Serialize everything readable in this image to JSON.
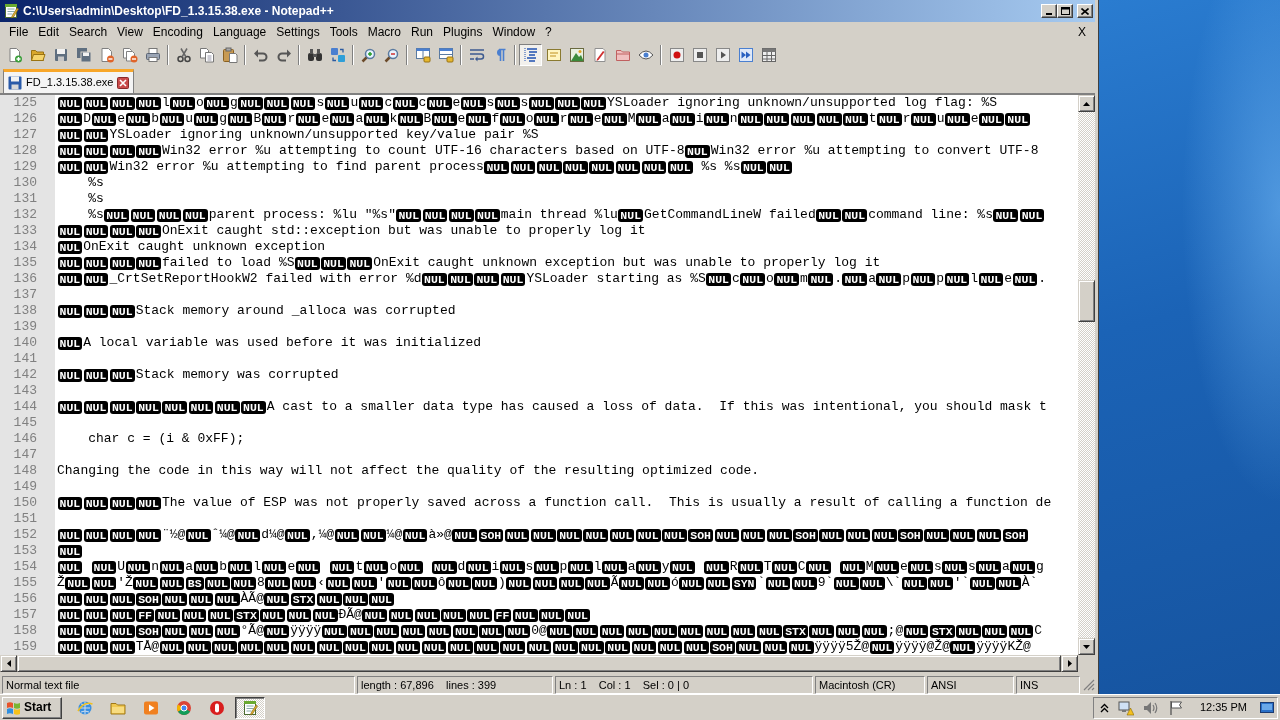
{
  "window": {
    "title": "C:\\Users\\admin\\Desktop\\FD_1.3.15.38.exe - Notepad++"
  },
  "menu": [
    "File",
    "Edit",
    "Search",
    "View",
    "Encoding",
    "Language",
    "Settings",
    "Tools",
    "Macro",
    "Run",
    "Plugins",
    "Window",
    "?"
  ],
  "menu_close": "X",
  "toolbar": [
    [
      {
        "pressed": false
      },
      {
        "pressed": false
      },
      {
        "pressed": false
      },
      {
        "pressed": false
      },
      {
        "pressed": false
      },
      {
        "pressed": false
      },
      {
        "pressed": false
      }
    ],
    [
      {
        "pressed": false
      },
      {
        "pressed": false
      },
      {
        "pressed": false
      }
    ],
    [
      {
        "pressed": false
      },
      {
        "pressed": false
      }
    ],
    [
      {
        "pressed": false
      },
      {
        "pressed": false
      }
    ],
    [
      {
        "pressed": false
      },
      {
        "pressed": false
      }
    ],
    [
      {
        "pressed": false
      },
      {
        "pressed": false
      }
    ],
    [
      {
        "pressed": false
      },
      {
        "pressed": false
      }
    ],
    [
      {
        "pressed": true
      },
      {
        "pressed": false
      },
      {
        "pressed": false
      },
      {
        "pressed": false
      },
      {
        "pressed": false
      },
      {
        "pressed": false
      }
    ],
    [
      {
        "pressed": false
      },
      {
        "pressed": false
      },
      {
        "pressed": false
      },
      {
        "pressed": false
      },
      {
        "pressed": false
      }
    ]
  ],
  "tabs": [
    {
      "label": "FD_1.3.15.38.exe",
      "selected": true,
      "modified": false
    }
  ],
  "editor": {
    "lines": [
      {
        "number": "125",
        "segments": [
          {
            "ctrl": "NUL"
          },
          {
            "ctrl": "NUL"
          },
          {
            "ctrl": "NUL"
          },
          {
            "ctrl": "NUL"
          },
          {
            "text": "l"
          },
          {
            "ctrl": "NUL"
          },
          {
            "text": "o"
          },
          {
            "ctrl": "NUL"
          },
          {
            "text": "g"
          },
          {
            "ctrl": "NUL"
          },
          {
            "ctrl": "NUL"
          },
          {
            "ctrl": "NUL"
          },
          {
            "text": "s"
          },
          {
            "ctrl": "NUL"
          },
          {
            "text": "u"
          },
          {
            "ctrl": "NUL"
          },
          {
            "text": "c"
          },
          {
            "ctrl": "NUL"
          },
          {
            "text": "c"
          },
          {
            "ctrl": "NUL"
          },
          {
            "text": "e"
          },
          {
            "ctrl": "NUL"
          },
          {
            "text": "s"
          },
          {
            "ctrl": "NUL"
          },
          {
            "text": "s"
          },
          {
            "ctrl": "NUL"
          },
          {
            "ctrl": "NUL"
          },
          {
            "ctrl": "NUL"
          },
          {
            "text": "YSLoader ignoring unknown/unsupported log flag: %S"
          }
        ]
      },
      {
        "number": "126",
        "segments": [
          {
            "ctrl": "NUL"
          },
          {
            "text": "D"
          },
          {
            "ctrl": "NUL"
          },
          {
            "text": "e"
          },
          {
            "ctrl": "NUL"
          },
          {
            "text": "b"
          },
          {
            "ctrl": "NUL"
          },
          {
            "text": "u"
          },
          {
            "ctrl": "NUL"
          },
          {
            "text": "g"
          },
          {
            "ctrl": "NUL"
          },
          {
            "text": "B"
          },
          {
            "ctrl": "NUL"
          },
          {
            "text": "r"
          },
          {
            "ctrl": "NUL"
          },
          {
            "text": "e"
          },
          {
            "ctrl": "NUL"
          },
          {
            "text": "a"
          },
          {
            "ctrl": "NUL"
          },
          {
            "text": "k"
          },
          {
            "ctrl": "NUL"
          },
          {
            "text": "B"
          },
          {
            "ctrl": "NUL"
          },
          {
            "text": "e"
          },
          {
            "ctrl": "NUL"
          },
          {
            "text": "f"
          },
          {
            "ctrl": "NUL"
          },
          {
            "text": "o"
          },
          {
            "ctrl": "NUL"
          },
          {
            "text": "r"
          },
          {
            "ctrl": "NUL"
          },
          {
            "text": "e"
          },
          {
            "ctrl": "NUL"
          },
          {
            "text": "M"
          },
          {
            "ctrl": "NUL"
          },
          {
            "text": "a"
          },
          {
            "ctrl": "NUL"
          },
          {
            "text": "i"
          },
          {
            "ctrl": "NUL"
          },
          {
            "text": "n"
          },
          {
            "ctrl": "NUL"
          },
          {
            "ctrl": "NUL"
          },
          {
            "ctrl": "NUL"
          },
          {
            "ctrl": "NUL"
          },
          {
            "ctrl": "NUL"
          },
          {
            "text": "t"
          },
          {
            "ctrl": "NUL"
          },
          {
            "text": "r"
          },
          {
            "ctrl": "NUL"
          },
          {
            "text": "u"
          },
          {
            "ctrl": "NUL"
          },
          {
            "text": "e"
          },
          {
            "ctrl": "NUL"
          },
          {
            "ctrl": "NUL"
          }
        ]
      },
      {
        "number": "127",
        "segments": [
          {
            "ctrl": "NUL"
          },
          {
            "ctrl": "NUL"
          },
          {
            "text": "YSLoader ignoring unknown/unsupported key/value pair %S"
          }
        ]
      },
      {
        "number": "128",
        "segments": [
          {
            "ctrl": "NUL"
          },
          {
            "ctrl": "NUL"
          },
          {
            "ctrl": "NUL"
          },
          {
            "ctrl": "NUL"
          },
          {
            "text": "Win32 error %u attempting to count UTF-16 characters based on UTF-8"
          },
          {
            "ctrl": "NUL"
          },
          {
            "text": "Win32 error %u attempting to convert UTF-8"
          }
        ]
      },
      {
        "number": "129",
        "segments": [
          {
            "ctrl": "NUL"
          },
          {
            "ctrl": "NUL"
          },
          {
            "text": "Win32 error %u attempting to find parent process"
          },
          {
            "ctrl": "NUL"
          },
          {
            "ctrl": "NUL"
          },
          {
            "ctrl": "NUL"
          },
          {
            "ctrl": "NUL"
          },
          {
            "ctrl": "NUL"
          },
          {
            "ctrl": "NUL"
          },
          {
            "ctrl": "NUL"
          },
          {
            "ctrl": "NUL"
          },
          {
            "text": " %s %s"
          },
          {
            "ctrl": "NUL"
          },
          {
            "ctrl": "NUL"
          }
        ]
      },
      {
        "number": "130",
        "segments": [
          {
            "text": "    %s"
          }
        ]
      },
      {
        "number": "131",
        "segments": [
          {
            "text": "    %s"
          }
        ]
      },
      {
        "number": "132",
        "segments": [
          {
            "text": "    %s"
          },
          {
            "ctrl": "NUL"
          },
          {
            "ctrl": "NUL"
          },
          {
            "ctrl": "NUL"
          },
          {
            "ctrl": "NUL"
          },
          {
            "text": "parent process: %lu \"%s\""
          },
          {
            "ctrl": "NUL"
          },
          {
            "ctrl": "NUL"
          },
          {
            "ctrl": "NUL"
          },
          {
            "ctrl": "NUL"
          },
          {
            "text": "main thread %lu"
          },
          {
            "ctrl": "NUL"
          },
          {
            "text": "GetCommandLineW failed"
          },
          {
            "ctrl": "NUL"
          },
          {
            "ctrl": "NUL"
          },
          {
            "text": "command line: %s"
          },
          {
            "ctrl": "NUL"
          },
          {
            "ctrl": "NUL"
          }
        ]
      },
      {
        "number": "133",
        "segments": [
          {
            "ctrl": "NUL"
          },
          {
            "ctrl": "NUL"
          },
          {
            "ctrl": "NUL"
          },
          {
            "ctrl": "NUL"
          },
          {
            "text": "OnExit caught std::exception but was unable to properly log it"
          }
        ]
      },
      {
        "number": "134",
        "segments": [
          {
            "ctrl": "NUL"
          },
          {
            "text": "OnExit caught unknown exception"
          }
        ]
      },
      {
        "number": "135",
        "segments": [
          {
            "ctrl": "NUL"
          },
          {
            "ctrl": "NUL"
          },
          {
            "ctrl": "NUL"
          },
          {
            "ctrl": "NUL"
          },
          {
            "text": "failed to load %S"
          },
          {
            "ctrl": "NUL"
          },
          {
            "ctrl": "NUL"
          },
          {
            "ctrl": "NUL"
          },
          {
            "text": "OnExit caught unknown exception but was unable to properly log it"
          }
        ]
      },
      {
        "number": "136",
        "segments": [
          {
            "ctrl": "NUL"
          },
          {
            "ctrl": "NUL"
          },
          {
            "text": "_CrtSetReportHookW2 failed with error %d"
          },
          {
            "ctrl": "NUL"
          },
          {
            "ctrl": "NUL"
          },
          {
            "ctrl": "NUL"
          },
          {
            "ctrl": "NUL"
          },
          {
            "text": "YSLoader starting as %S"
          },
          {
            "ctrl": "NUL"
          },
          {
            "text": "c"
          },
          {
            "ctrl": "NUL"
          },
          {
            "text": "o"
          },
          {
            "ctrl": "NUL"
          },
          {
            "text": "m"
          },
          {
            "ctrl": "NUL"
          },
          {
            "text": "."
          },
          {
            "ctrl": "NUL"
          },
          {
            "text": "a"
          },
          {
            "ctrl": "NUL"
          },
          {
            "text": "p"
          },
          {
            "ctrl": "NUL"
          },
          {
            "text": "p"
          },
          {
            "ctrl": "NUL"
          },
          {
            "text": "l"
          },
          {
            "ctrl": "NUL"
          },
          {
            "text": "e"
          },
          {
            "ctrl": "NUL"
          },
          {
            "text": "."
          }
        ]
      },
      {
        "number": "137"
      },
      {
        "number": "138",
        "segments": [
          {
            "ctrl": "NUL"
          },
          {
            "ctrl": "NUL"
          },
          {
            "ctrl": "NUL"
          },
          {
            "text": "Stack memory around _alloca was corrupted"
          }
        ]
      },
      {
        "number": "139"
      },
      {
        "number": "140",
        "segments": [
          {
            "ctrl": "NUL"
          },
          {
            "text": "A local variable was used before it was initialized"
          }
        ]
      },
      {
        "number": "141"
      },
      {
        "number": "142",
        "segments": [
          {
            "ctrl": "NUL"
          },
          {
            "ctrl": "NUL"
          },
          {
            "ctrl": "NUL"
          },
          {
            "text": "Stack memory was corrupted"
          }
        ]
      },
      {
        "number": "143"
      },
      {
        "number": "144",
        "segments": [
          {
            "ctrl": "NUL"
          },
          {
            "ctrl": "NUL"
          },
          {
            "ctrl": "NUL"
          },
          {
            "ctrl": "NUL"
          },
          {
            "ctrl": "NUL"
          },
          {
            "ctrl": "NUL"
          },
          {
            "ctrl": "NUL"
          },
          {
            "ctrl": "NUL"
          },
          {
            "text": "A cast to a smaller data type has caused a loss of data.  If this was intentional, you should mask t"
          }
        ]
      },
      {
        "number": "145"
      },
      {
        "number": "146",
        "segments": [
          {
            "text": "    char c = (i & 0xFF);"
          }
        ]
      },
      {
        "number": "147"
      },
      {
        "number": "148",
        "segments": [
          {
            "text": "Changing the code in this way will not affect the quality of the resulting optimized code."
          }
        ]
      },
      {
        "number": "149"
      },
      {
        "number": "150",
        "segments": [
          {
            "ctrl": "NUL"
          },
          {
            "ctrl": "NUL"
          },
          {
            "ctrl": "NUL"
          },
          {
            "ctrl": "NUL"
          },
          {
            "text": "The value of ESP was not properly saved across a function call.  This is usually a result of calling a function de"
          }
        ]
      },
      {
        "number": "151"
      },
      {
        "number": "152",
        "segments": [
          {
            "ctrl": "NUL"
          },
          {
            "ctrl": "NUL"
          },
          {
            "ctrl": "NUL"
          },
          {
            "ctrl": "NUL"
          },
          {
            "text": "¨½@"
          },
          {
            "ctrl": "NUL"
          },
          {
            "text": "ˆ¼@"
          },
          {
            "ctrl": "NUL"
          },
          {
            "text": "d¼@"
          },
          {
            "ctrl": "NUL"
          },
          {
            "text": ",¼@"
          },
          {
            "ctrl": "NUL"
          },
          {
            "ctrl": "NUL"
          },
          {
            "text": "¼@"
          },
          {
            "ctrl": "NUL"
          },
          {
            "text": "à»@"
          },
          {
            "ctrl": "NUL"
          },
          {
            "ctrl": "SOH"
          },
          {
            "ctrl": "NUL"
          },
          {
            "ctrl": "NUL"
          },
          {
            "ctrl": "NUL"
          },
          {
            "ctrl": "NUL"
          },
          {
            "ctrl": "NUL"
          },
          {
            "ctrl": "NUL"
          },
          {
            "ctrl": "NUL"
          },
          {
            "ctrl": "SOH"
          },
          {
            "ctrl": "NUL"
          },
          {
            "ctrl": "NUL"
          },
          {
            "ctrl": "NUL"
          },
          {
            "ctrl": "SOH"
          },
          {
            "ctrl": "NUL"
          },
          {
            "ctrl": "NUL"
          },
          {
            "ctrl": "NUL"
          },
          {
            "ctrl": "SOH"
          },
          {
            "ctrl": "NUL"
          },
          {
            "ctrl": "NUL"
          },
          {
            "ctrl": "NUL"
          },
          {
            "ctrl": "SOH"
          }
        ]
      },
      {
        "number": "153",
        "segments": [
          {
            "ctrl": "NUL"
          }
        ]
      },
      {
        "number": "154",
        "segments": [
          {
            "ctrl": "NUL"
          },
          {
            "blank": true
          },
          {
            "ctrl": "NUL"
          },
          {
            "text": "U"
          },
          {
            "ctrl": "NUL"
          },
          {
            "text": "n"
          },
          {
            "ctrl": "NUL"
          },
          {
            "text": "a"
          },
          {
            "ctrl": "NUL"
          },
          {
            "text": "b"
          },
          {
            "ctrl": "NUL"
          },
          {
            "text": "l"
          },
          {
            "ctrl": "NUL"
          },
          {
            "text": "e"
          },
          {
            "ctrl": "NUL"
          },
          {
            "blank": true
          },
          {
            "ctrl": "NUL"
          },
          {
            "text": "t"
          },
          {
            "ctrl": "NUL"
          },
          {
            "text": "o"
          },
          {
            "ctrl": "NUL"
          },
          {
            "blank": true
          },
          {
            "ctrl": "NUL"
          },
          {
            "text": "d"
          },
          {
            "ctrl": "NUL"
          },
          {
            "text": "i"
          },
          {
            "ctrl": "NUL"
          },
          {
            "text": "s"
          },
          {
            "ctrl": "NUL"
          },
          {
            "text": "p"
          },
          {
            "ctrl": "NUL"
          },
          {
            "text": "l"
          },
          {
            "ctrl": "NUL"
          },
          {
            "text": "a"
          },
          {
            "ctrl": "NUL"
          },
          {
            "text": "y"
          },
          {
            "ctrl": "NUL"
          },
          {
            "blank": true
          },
          {
            "ctrl": "NUL"
          },
          {
            "text": "R"
          },
          {
            "ctrl": "NUL"
          },
          {
            "text": "T"
          },
          {
            "ctrl": "NUL"
          },
          {
            "text": "C"
          },
          {
            "ctrl": "NUL"
          },
          {
            "blank": true
          },
          {
            "ctrl": "NUL"
          },
          {
            "text": "M"
          },
          {
            "ctrl": "NUL"
          },
          {
            "text": "e"
          },
          {
            "ctrl": "NUL"
          },
          {
            "text": "s"
          },
          {
            "ctrl": "NUL"
          },
          {
            "text": "s"
          },
          {
            "ctrl": "NUL"
          },
          {
            "text": "a"
          },
          {
            "ctrl": "NUL"
          },
          {
            "text": "g"
          }
        ]
      },
      {
        "number": "155",
        "segments": [
          {
            "text": "Ž"
          },
          {
            "ctrl": "NUL"
          },
          {
            "ctrl": "NUL"
          },
          {
            "text": "'Ž"
          },
          {
            "ctrl": "NUL"
          },
          {
            "ctrl": "NUL"
          },
          {
            "ctrl": "BS"
          },
          {
            "ctrl": "NUL"
          },
          {
            "ctrl": "NUL"
          },
          {
            "text": "8"
          },
          {
            "ctrl": "NUL"
          },
          {
            "ctrl": "NUL"
          },
          {
            "text": "‹"
          },
          {
            "ctrl": "NUL"
          },
          {
            "ctrl": "NUL"
          },
          {
            "text": "'"
          },
          {
            "ctrl": "NUL"
          },
          {
            "ctrl": "NUL"
          },
          {
            "text": "ô"
          },
          {
            "ctrl": "NUL"
          },
          {
            "ctrl": "NUL"
          },
          {
            "text": ")"
          },
          {
            "ctrl": "NUL"
          },
          {
            "ctrl": "NUL"
          },
          {
            "ctrl": "NUL"
          },
          {
            "ctrl": "NUL"
          },
          {
            "text": "Ã"
          },
          {
            "ctrl": "NUL"
          },
          {
            "ctrl": "NUL"
          },
          {
            "text": "ó"
          },
          {
            "ctrl": "NUL"
          },
          {
            "ctrl": "NUL"
          },
          {
            "ctrl": "SYN"
          },
          {
            "text": "`"
          },
          {
            "ctrl": "NUL"
          },
          {
            "ctrl": "NUL"
          },
          {
            "text": "9`"
          },
          {
            "ctrl": "NUL"
          },
          {
            "ctrl": "NUL"
          },
          {
            "text": "\\`"
          },
          {
            "ctrl": "NUL"
          },
          {
            "ctrl": "NUL"
          },
          {
            "text": "'`"
          },
          {
            "ctrl": "NUL"
          },
          {
            "ctrl": "NUL"
          },
          {
            "text": "À`"
          }
        ]
      },
      {
        "number": "156",
        "segments": [
          {
            "ctrl": "NUL"
          },
          {
            "ctrl": "NUL"
          },
          {
            "ctrl": "NUL"
          },
          {
            "ctrl": "SOH"
          },
          {
            "ctrl": "NUL"
          },
          {
            "ctrl": "NUL"
          },
          {
            "ctrl": "NUL"
          },
          {
            "text": "ÀÃ@"
          },
          {
            "ctrl": "NUL"
          },
          {
            "ctrl": "STX"
          },
          {
            "ctrl": "NUL"
          },
          {
            "ctrl": "NUL"
          },
          {
            "ctrl": "NUL"
          }
        ]
      },
      {
        "number": "157",
        "segments": [
          {
            "ctrl": "NUL"
          },
          {
            "ctrl": "NUL"
          },
          {
            "ctrl": "NUL"
          },
          {
            "ctrl": "FF"
          },
          {
            "ctrl": "NUL"
          },
          {
            "ctrl": "NUL"
          },
          {
            "ctrl": "NUL"
          },
          {
            "ctrl": "STX"
          },
          {
            "ctrl": "NUL"
          },
          {
            "ctrl": "NUL"
          },
          {
            "ctrl": "NUL"
          },
          {
            "text": "ÐÃ@"
          },
          {
            "ctrl": "NUL"
          },
          {
            "ctrl": "NUL"
          },
          {
            "ctrl": "NUL"
          },
          {
            "ctrl": "NUL"
          },
          {
            "ctrl": "NUL"
          },
          {
            "ctrl": "FF"
          },
          {
            "ctrl": "NUL"
          },
          {
            "ctrl": "NUL"
          },
          {
            "ctrl": "NUL"
          }
        ]
      },
      {
        "number": "158",
        "segments": [
          {
            "ctrl": "NUL"
          },
          {
            "ctrl": "NUL"
          },
          {
            "ctrl": "NUL"
          },
          {
            "ctrl": "SOH"
          },
          {
            "ctrl": "NUL"
          },
          {
            "ctrl": "NUL"
          },
          {
            "ctrl": "NUL"
          },
          {
            "text": "°Ã@"
          },
          {
            "ctrl": "NUL"
          },
          {
            "text": "ÿÿÿÿ"
          },
          {
            "ctrl": "NUL"
          },
          {
            "ctrl": "NUL"
          },
          {
            "ctrl": "NUL"
          },
          {
            "ctrl": "NUL"
          },
          {
            "ctrl": "NUL"
          },
          {
            "ctrl": "NUL"
          },
          {
            "ctrl": "NUL"
          },
          {
            "ctrl": "NUL"
          },
          {
            "text": "0@"
          },
          {
            "ctrl": "NUL"
          },
          {
            "ctrl": "NUL"
          },
          {
            "ctrl": "NUL"
          },
          {
            "ctrl": "NUL"
          },
          {
            "ctrl": "NUL"
          },
          {
            "ctrl": "NUL"
          },
          {
            "ctrl": "NUL"
          },
          {
            "ctrl": "NUL"
          },
          {
            "ctrl": "NUL"
          },
          {
            "ctrl": "STX"
          },
          {
            "ctrl": "NUL"
          },
          {
            "ctrl": "NUL"
          },
          {
            "ctrl": "NUL"
          },
          {
            "text": ";@"
          },
          {
            "ctrl": "NUL"
          },
          {
            "ctrl": "STX"
          },
          {
            "ctrl": "NUL"
          },
          {
            "ctrl": "NUL"
          },
          {
            "ctrl": "NUL"
          },
          {
            "text": "C"
          }
        ]
      },
      {
        "number": "159",
        "segments": [
          {
            "ctrl": "NUL"
          },
          {
            "ctrl": "NUL"
          },
          {
            "ctrl": "NUL"
          },
          {
            "text": "TÅ@"
          },
          {
            "ctrl": "NUL"
          },
          {
            "ctrl": "NUL"
          },
          {
            "ctrl": "NUL"
          },
          {
            "ctrl": "NUL"
          },
          {
            "ctrl": "NUL"
          },
          {
            "ctrl": "NUL"
          },
          {
            "ctrl": "NUL"
          },
          {
            "ctrl": "NUL"
          },
          {
            "ctrl": "NUL"
          },
          {
            "ctrl": "NUL"
          },
          {
            "ctrl": "NUL"
          },
          {
            "ctrl": "NUL"
          },
          {
            "ctrl": "NUL"
          },
          {
            "ctrl": "NUL"
          },
          {
            "ctrl": "NUL"
          },
          {
            "ctrl": "NUL"
          },
          {
            "ctrl": "NUL"
          },
          {
            "ctrl": "NUL"
          },
          {
            "ctrl": "NUL"
          },
          {
            "ctrl": "NUL"
          },
          {
            "ctrl": "NUL"
          },
          {
            "ctrl": "SOH"
          },
          {
            "ctrl": "NUL"
          },
          {
            "ctrl": "NUL"
          },
          {
            "ctrl": "NUL"
          },
          {
            "text": "ÿÿÿÿ5Ž@"
          },
          {
            "ctrl": "NUL"
          },
          {
            "text": "ÿÿÿÿ@Ž@"
          },
          {
            "ctrl": "NUL"
          },
          {
            "text": "ÿÿÿÿKŽ@"
          }
        ]
      }
    ]
  },
  "status_bar": [
    "Normal text file",
    "length : 67,896    lines : 399",
    "Ln : 1    Col : 1    Sel : 0 | 0",
    "Macintosh (CR)",
    "ANSI",
    "INS"
  ],
  "taskbar": {
    "start": "Start",
    "apps": [
      {
        "active": false
      },
      {
        "active": false
      },
      {
        "active": false
      },
      {
        "active": false
      },
      {
        "active": false
      },
      {
        "active": true
      }
    ],
    "clock": "12:35 PM"
  }
}
